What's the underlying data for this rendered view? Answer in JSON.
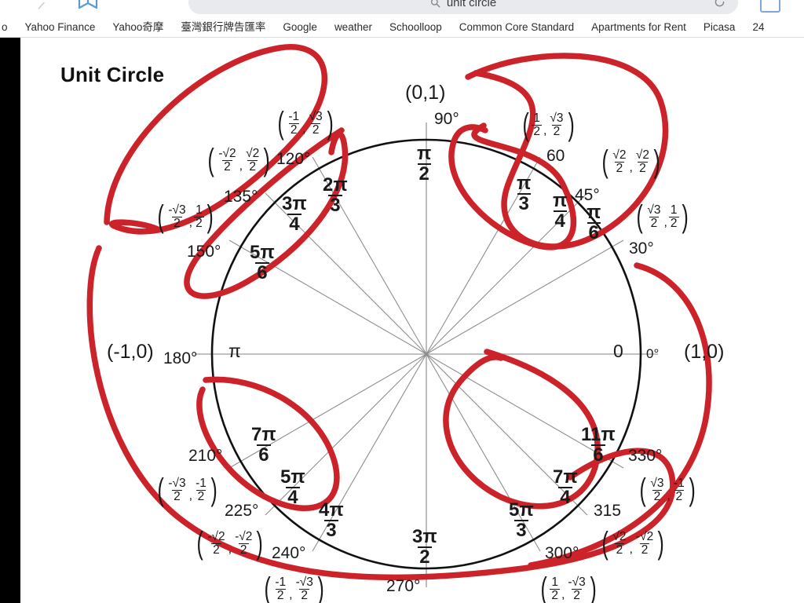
{
  "browser": {
    "search_query": "unit circle",
    "icons": {
      "forward": "forward-arrow-icon",
      "bookmark": "bookmark-icon",
      "search": "search-icon",
      "reload": "reload-icon",
      "tab": "tab-square-icon"
    },
    "bookmarks": [
      "o",
      "Yahoo Finance",
      "Yahoo奇摩",
      "臺灣銀行牌告匯率",
      "Google",
      "weather",
      "Schoolloop",
      "Common Core Standard",
      "Apartments for Rent",
      "Picasa",
      "24"
    ]
  },
  "document": {
    "title": "Unit Circle",
    "axis_points": {
      "right": "(1,0)",
      "top": "(0,1)",
      "left": "(-1,0)"
    },
    "axis_radians": {
      "zero": "0",
      "top": {
        "num": "π",
        "den": "2"
      },
      "left": "π",
      "bottom": {
        "num": "3π",
        "den": "2"
      }
    },
    "axis_degrees": {
      "zero": "0°",
      "top": "90°",
      "left": "180°",
      "bottom": "270°"
    },
    "angles": [
      {
        "deg": "30°",
        "num": "π",
        "den": "6",
        "x": "√3",
        "xd": "2",
        "y": "1",
        "yd": "2"
      },
      {
        "deg": "45°",
        "num": "π",
        "den": "4",
        "x": "√2",
        "xd": "2",
        "y": "√2",
        "yd": "2"
      },
      {
        "deg": "60",
        "num": "π",
        "den": "3",
        "x": "1",
        "xd": "2",
        "y": "√3",
        "yd": "2"
      },
      {
        "deg": "120°",
        "num": "2π",
        "den": "3",
        "x": "-1",
        "xd": "2",
        "y": "√3",
        "yd": "2"
      },
      {
        "deg": "135°",
        "num": "3π",
        "den": "4",
        "x": "-√2",
        "xd": "2",
        "y": "√2",
        "yd": "2"
      },
      {
        "deg": "150°",
        "num": "5π",
        "den": "6",
        "x": "-√3",
        "xd": "2",
        "y": "1",
        "yd": "2"
      },
      {
        "deg": "210°",
        "num": "7π",
        "den": "6",
        "x": "-√3",
        "xd": "2",
        "y": "-1",
        "yd": "2"
      },
      {
        "deg": "225°",
        "num": "5π",
        "den": "4",
        "x": "-√2",
        "xd": "2",
        "y": "-√2",
        "yd": "2"
      },
      {
        "deg": "240°",
        "num": "4π",
        "den": "3",
        "x": "-1",
        "xd": "2",
        "y": "-√3",
        "yd": "2"
      },
      {
        "deg": "300°",
        "num": "5π",
        "den": "3",
        "x": "1",
        "xd": "2",
        "y": "-√3",
        "yd": "2"
      },
      {
        "deg": "315",
        "num": "7π",
        "den": "4",
        "x": "√2",
        "xd": "2",
        "y": "-√2",
        "yd": "2"
      },
      {
        "deg": "330°",
        "num": "11π",
        "den": "6",
        "x": "√3",
        "xd": "2",
        "y": "-1",
        "yd": "2"
      }
    ],
    "annotation": {
      "color": "#cc2229",
      "kind": "hand-drawn-red-ink-loops",
      "count": 8
    }
  }
}
